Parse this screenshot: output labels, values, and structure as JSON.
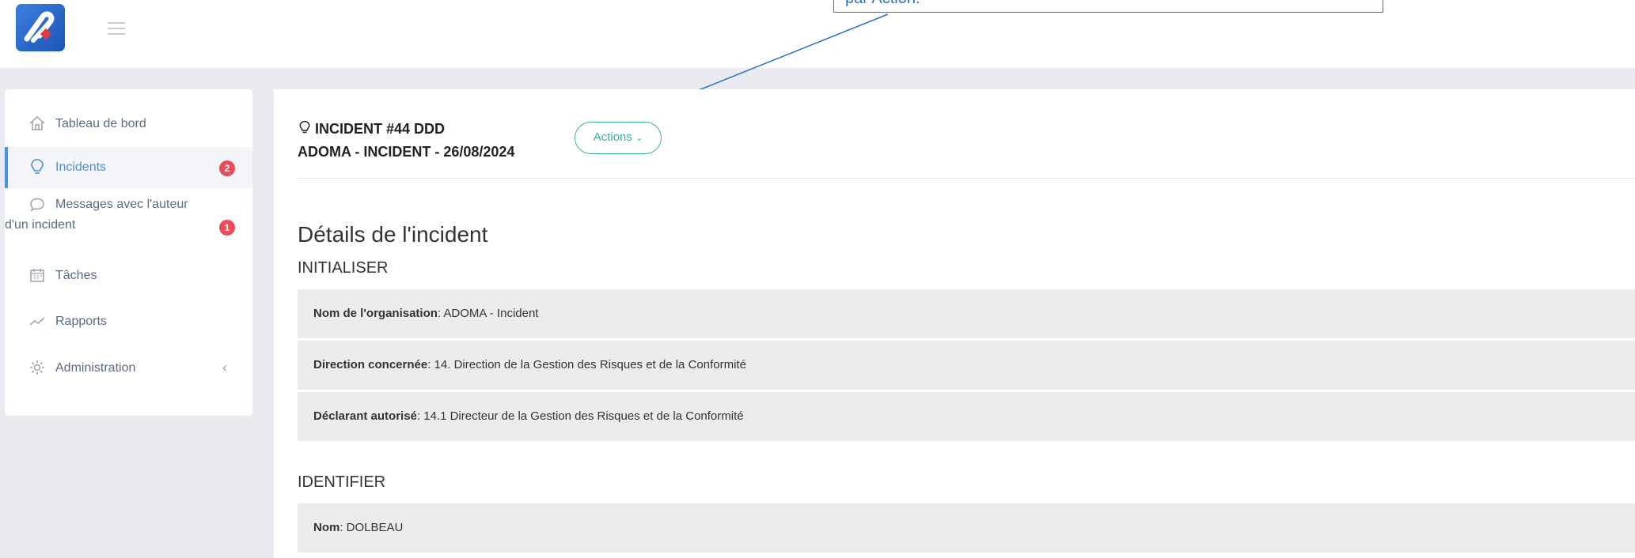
{
  "callout": {
    "text": "par Action."
  },
  "sidebar": {
    "items": [
      {
        "label": "Tableau de bord"
      },
      {
        "label": "Incidents",
        "badge": "2"
      },
      {
        "label_line1": "Messages avec l'auteur",
        "label_line2": "d'un incident",
        "badge": "1"
      },
      {
        "label": "Tâches"
      },
      {
        "label": "Rapports"
      },
      {
        "label": "Administration"
      }
    ]
  },
  "incident": {
    "title": "INCIDENT #44 DDD",
    "subtitle": "ADOMA - INCIDENT - 26/08/2024",
    "actions_label": "Actions"
  },
  "details": {
    "heading": "Détails de l'incident",
    "sections": [
      {
        "title": "INITIALISER",
        "rows": [
          {
            "label": "Nom de l'organisation",
            "value": ": ADOMA - Incident"
          },
          {
            "label": "Direction concernée",
            "value": ": 14. Direction de la Gestion des Risques et de la Conformité"
          },
          {
            "label": "Déclarant autorisé",
            "value": ": 14.1 Directeur de la Gestion des Risques et de la Conformité"
          }
        ]
      },
      {
        "title": "IDENTIFIER",
        "rows": [
          {
            "label": "Nom",
            "value": ": DOLBEAU"
          }
        ]
      }
    ]
  },
  "colors": {
    "accent": "#4a8fe0",
    "badge": "#ea4c59",
    "actions": "#36b59b",
    "callout": "#2a74c9"
  }
}
